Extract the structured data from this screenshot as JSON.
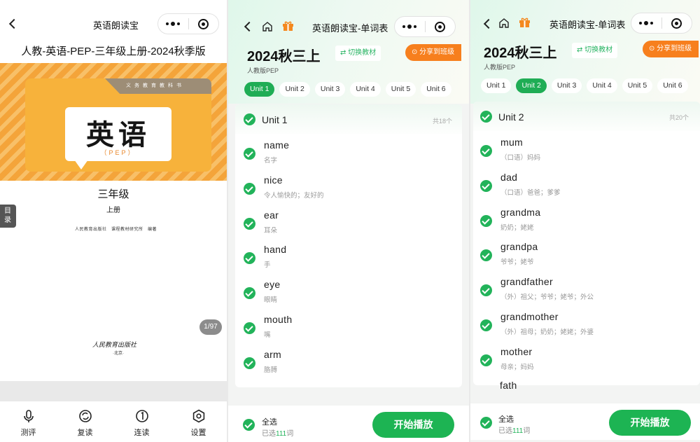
{
  "screen1": {
    "nav_title": "英语朗读宝",
    "book_title": "人教-英语-PEP-三年级上册-2024秋季版",
    "cover": {
      "series_text": "义务教育教科书",
      "subject": "英语",
      "edition": "（PEP）",
      "grade": "三年级",
      "volume": "上册",
      "publisher_line": "人民教育出版社　课程教材研究所　编著",
      "press_signature": "人民教育出版社",
      "press_city": "·北京·"
    },
    "toc_label": "目录",
    "page_indicator": "1/97",
    "tabs": [
      {
        "label": "测评",
        "icon": "microphone-icon"
      },
      {
        "label": "复读",
        "icon": "repeat-icon"
      },
      {
        "label": "连读",
        "icon": "continuous-icon"
      },
      {
        "label": "设置",
        "icon": "settings-icon"
      }
    ]
  },
  "screen2": {
    "nav_title": "英语朗读宝-单词表",
    "big_title": "2024秋三上",
    "switch_label": "⇄ 切换教材",
    "share_label": "分享到班级",
    "edition_label": "人教版PEP",
    "unit_tabs": [
      "Unit 1",
      "Unit 2",
      "Unit 3",
      "Unit 4",
      "Unit 5",
      "Unit 6"
    ],
    "active_tab": 0,
    "unit_name": "Unit 1",
    "unit_count": "共18个",
    "words": [
      {
        "word": "name",
        "meaning": "名字"
      },
      {
        "word": "nice",
        "meaning": "令人愉快的；友好的"
      },
      {
        "word": "ear",
        "meaning": "耳朵"
      },
      {
        "word": "hand",
        "meaning": "手"
      },
      {
        "word": "eye",
        "meaning": "眼睛"
      },
      {
        "word": "mouth",
        "meaning": "嘴"
      },
      {
        "word": "arm",
        "meaning": "胳膊"
      }
    ],
    "select_all": "全选",
    "selected_prefix": "已选",
    "selected_count": "111",
    "selected_suffix": "词",
    "play_label": "开始播放"
  },
  "screen3": {
    "nav_title": "英语朗读宝-单词表",
    "big_title": "2024秋三上",
    "switch_label": "⇄ 切换教材",
    "share_label": "分享到班级",
    "edition_label": "人教版PEP",
    "unit_tabs": [
      "Unit 1",
      "Unit 2",
      "Unit 3",
      "Unit 4",
      "Unit 5",
      "Unit 6"
    ],
    "active_tab": 1,
    "unit_name": "Unit 2",
    "unit_count": "共20个",
    "words": [
      {
        "word": "mum",
        "meaning": "（口语）妈妈"
      },
      {
        "word": "dad",
        "meaning": "（口语）爸爸；爹爹"
      },
      {
        "word": "grandma",
        "meaning": "奶奶；姥姥"
      },
      {
        "word": "grandpa",
        "meaning": "爷爷；姥爷"
      },
      {
        "word": "grandfather",
        "meaning": "（外）祖父；爷爷；姥爷；外公"
      },
      {
        "word": "grandmother",
        "meaning": "（外）祖母；奶奶；姥姥；外婆"
      },
      {
        "word": "mother",
        "meaning": "母亲；妈妈"
      }
    ],
    "partial_word": "fath",
    "select_all": "全选",
    "selected_prefix": "已选",
    "selected_count": "111",
    "selected_suffix": "词",
    "play_label": "开始播放"
  },
  "colors": {
    "accent_green": "#1fad55",
    "share_orange": "#f77f1d",
    "cover_orange": "#f7b23b"
  }
}
